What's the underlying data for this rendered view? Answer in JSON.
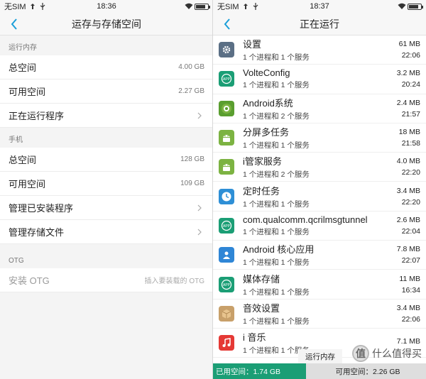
{
  "left": {
    "status": {
      "carrier": "无SIM",
      "time": "18:36"
    },
    "title": "运存与存储空间",
    "ram": {
      "label": "运行内存",
      "rows": [
        {
          "label": "总空间",
          "value": "4.00 GB"
        },
        {
          "label": "可用空间",
          "value": "2.27 GB"
        },
        {
          "label": "正在运行程序"
        }
      ]
    },
    "phone": {
      "label": "手机",
      "rows": [
        {
          "label": "总空间",
          "value": "128 GB"
        },
        {
          "label": "可用空间",
          "value": "109 GB"
        },
        {
          "label": "管理已安装程序"
        },
        {
          "label": "管理存储文件"
        }
      ]
    },
    "otg": {
      "label": "OTG",
      "row": {
        "label": "安装 OTG",
        "value": "插入要装载的 OTG"
      }
    }
  },
  "right": {
    "status": {
      "carrier": "无SIM",
      "time": "18:37"
    },
    "title": "正在运行",
    "processes": [
      {
        "name": "设置",
        "sub": "1 个进程和 1 个服务",
        "size": "61 MB",
        "time": "22:06",
        "icon": "settings-icon",
        "color": "#5b6f85"
      },
      {
        "name": "VolteConfig",
        "sub": "1 个进程和 1 个服务",
        "size": "3.2 MB",
        "time": "20:24",
        "icon": "app-icon",
        "color": "#1b9e75"
      },
      {
        "name": "Android系统",
        "sub": "1 个进程和 2 个服务",
        "size": "2.4 MB",
        "time": "21:57",
        "icon": "android-system-icon",
        "color": "#5a9e2f"
      },
      {
        "name": "分屏多任务",
        "sub": "1 个进程和 1 个服务",
        "size": "18 MB",
        "time": "21:58",
        "icon": "android-icon",
        "color": "#7cb342"
      },
      {
        "name": "i管家服务",
        "sub": "1 个进程和 2 个服务",
        "size": "4.0 MB",
        "time": "22:20",
        "icon": "android-icon",
        "color": "#7cb342"
      },
      {
        "name": "定时任务",
        "sub": "1 个进程和 1 个服务",
        "size": "3.4 MB",
        "time": "22:20",
        "icon": "clock-icon",
        "color": "#2e8fd6"
      },
      {
        "name": "com.qualcomm.qcrilmsgtunnel",
        "sub": "1 个进程和 1 个服务",
        "size": "2.6 MB",
        "time": "22:04",
        "icon": "app-icon",
        "color": "#1b9e75"
      },
      {
        "name": "Android 核心应用",
        "sub": "1 个进程和 1 个服务",
        "size": "7.8 MB",
        "time": "22:07",
        "icon": "contacts-icon",
        "color": "#2f86d6"
      },
      {
        "name": "媒体存储",
        "sub": "1 个进程和 1 个服务",
        "size": "11 MB",
        "time": "16:34",
        "icon": "app-icon",
        "color": "#1b9e75"
      },
      {
        "name": "音效设置",
        "sub": "1 个进程和 1 个服务",
        "size": "3.4 MB",
        "time": "22:06",
        "icon": "box-icon",
        "color": "#c8a06a"
      },
      {
        "name": "i 音乐",
        "sub": "1 个进程和 1 个服务",
        "size": "7.1 MB",
        "time": "",
        "icon": "music-icon",
        "color": "#e53935"
      }
    ],
    "memory": {
      "popup": "运行内存",
      "used": "已用空间：1.74 GB",
      "free": "可用空间：2.26 GB",
      "used_fraction": 0.435
    },
    "watermark": {
      "text": "什么值得买",
      "logo": "值"
    }
  }
}
